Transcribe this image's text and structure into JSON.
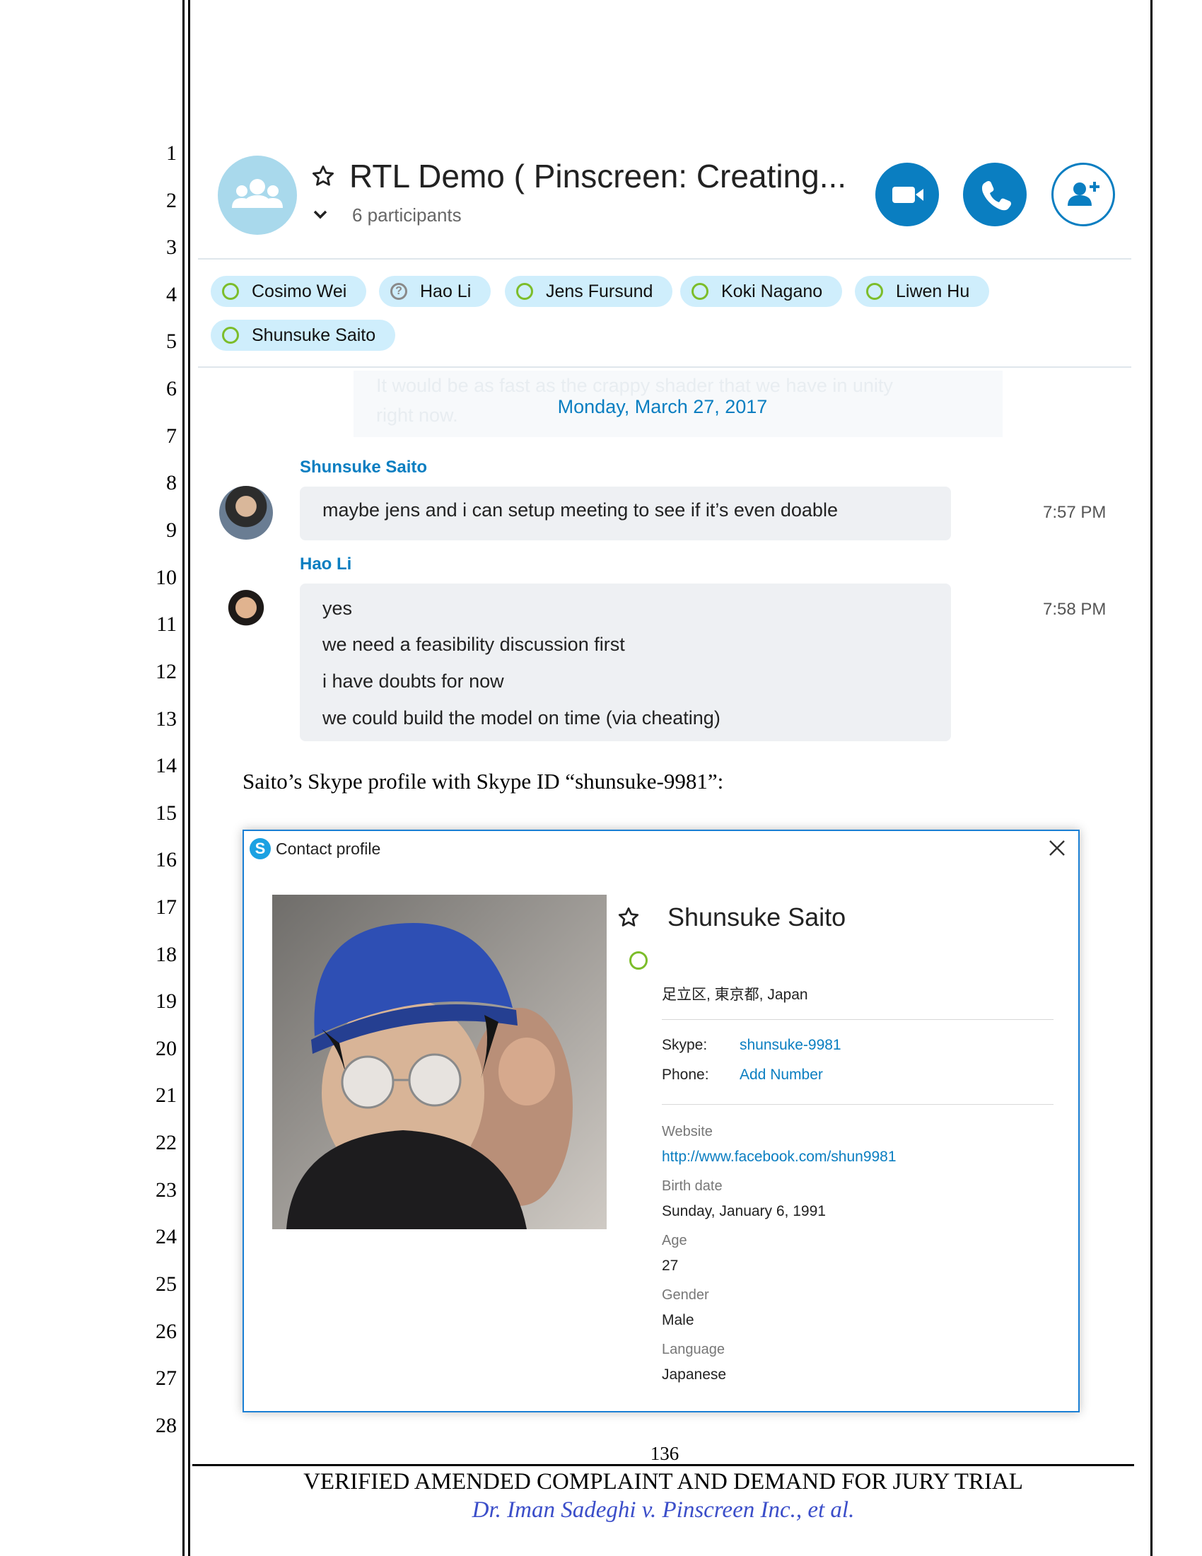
{
  "line_numbers": [
    "1",
    "2",
    "3",
    "4",
    "5",
    "6",
    "7",
    "8",
    "9",
    "10",
    "11",
    "12",
    "13",
    "14",
    "15",
    "16",
    "17",
    "18",
    "19",
    "20",
    "21",
    "22",
    "23",
    "24",
    "25",
    "26",
    "27",
    "28"
  ],
  "chat": {
    "title": "RTL Demo ( Pinscreen: Creating...",
    "participant_count": "6 participants",
    "participants": [
      {
        "name": "Cosimo Wei",
        "status": "online"
      },
      {
        "name": "Hao Li",
        "status": "unknown"
      },
      {
        "name": "Jens Fursund",
        "status": "online"
      },
      {
        "name": "Koki Nagano",
        "status": "online"
      },
      {
        "name": "Liwen Hu",
        "status": "online"
      },
      {
        "name": "Shunsuke Saito",
        "status": "online"
      }
    ],
    "faded_text_line1": "It would be as fast as the crappy shader that we have  in unity",
    "faded_text_line2": "right now.",
    "date": "Monday, March 27, 2017",
    "messages": [
      {
        "sender": "Shunsuke Saito",
        "time": "7:57 PM",
        "lines": [
          "maybe jens and i can setup meeting to see if it’s even doable"
        ]
      },
      {
        "sender": "Hao Li",
        "time": "7:58 PM",
        "lines": [
          "yes",
          "we need a feasibility discussion first",
          "i have doubts for now",
          "we could build the model on time (via cheating)"
        ]
      }
    ],
    "accent_color": "#0a7ec1"
  },
  "caption": "Saito’s Skype profile with Skype ID “shunsuke-9981”:",
  "profile": {
    "window_title": "Contact profile",
    "name": "Shunsuke Saito",
    "location": "足立区, 東京都, Japan",
    "skype_label": "Skype:",
    "skype_id": "shunsuke-9981",
    "phone_label": "Phone:",
    "phone_value": "Add Number",
    "website_label": "Website",
    "website_value": "http://www.facebook.com/shun9981",
    "birth_label": "Birth date",
    "birth_value": "Sunday, January 6, 1991",
    "age_label": "Age",
    "age_value": "27",
    "gender_label": "Gender",
    "gender_value": "Male",
    "language_label": "Language",
    "language_value": "Japanese"
  },
  "footer": {
    "page_number": "136",
    "title": "VERIFIED AMENDED COMPLAINT AND DEMAND FOR JURY TRIAL",
    "case": "Dr. Iman Sadeghi v. Pinscreen Inc., et al."
  }
}
